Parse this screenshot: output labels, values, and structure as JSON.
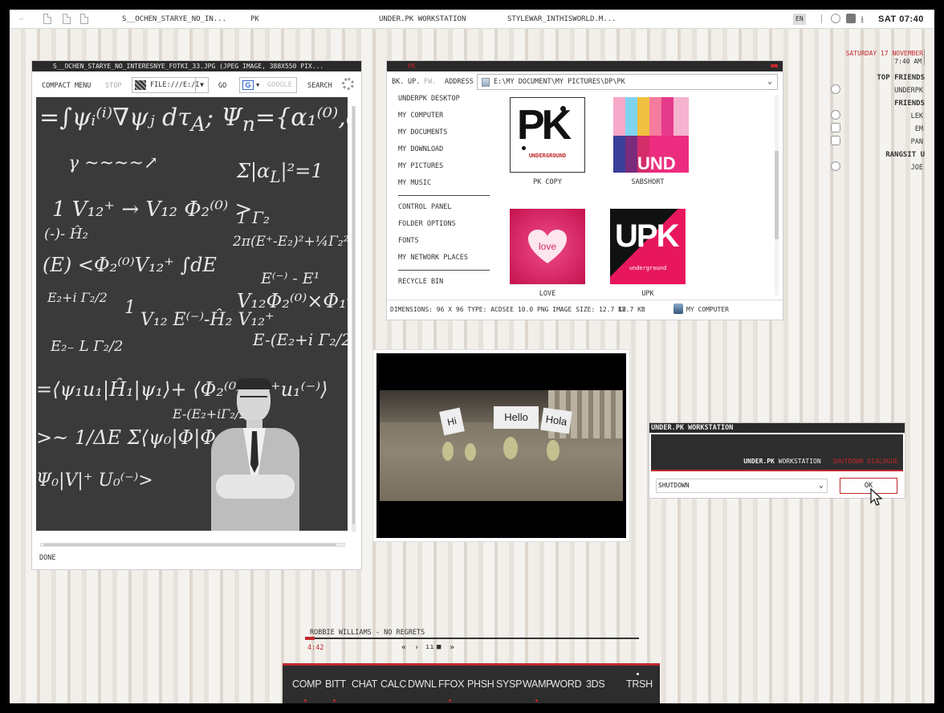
{
  "topbar": {
    "minimize_glyph": "–",
    "tasks": [
      "S__OCHEN_STARYE_NO_IN...",
      "PK",
      "UNDER.PK WORKSTATION",
      "STYLEWAR_INTHISWORLD.M..."
    ],
    "lang": "EN",
    "clock": "SAT 07:40"
  },
  "image_viewer": {
    "title": "S__OCHEN_STARYE_NO_INTERESNYE_FOTKI_33.JPG (JPEG IMAGE, 388X550 PIX...",
    "toolbar": {
      "compact_menu": "COMPACT MENU",
      "stop": "STOP",
      "url": "FILE:///E:/I",
      "go": "GO",
      "google_placeholder": "GOOGLE",
      "search": "SEARCH"
    },
    "status": "DONE"
  },
  "explorer": {
    "title": "PK",
    "nav": {
      "back": "BK.",
      "up": "UP.",
      "forward": "FW.",
      "address_label": "ADDRESS"
    },
    "address": "E:\\MY DOCUMENT\\MY PICTURES\\DP\\PK",
    "sidebar_group1": [
      "UNDERPK DESKTOP",
      "MY COMPUTER",
      "MY DOCUMENTS",
      "MY DOWNLOAD",
      "MY PICTURES",
      "MY MUSIC"
    ],
    "sidebar_group2": [
      "CONTROL PANEL",
      "FOLDER OPTIONS",
      "FONTS",
      "MY NETWORK PLACES"
    ],
    "sidebar_group3": [
      "RECYCLE BIN"
    ],
    "files": [
      {
        "name": "PK COPY",
        "art": "PK",
        "art_sub": "UNDERGROUND"
      },
      {
        "name": "SABSHORT",
        "art": "UND"
      },
      {
        "name": "LOVE",
        "art": "love"
      },
      {
        "name": "UPK",
        "art": "UPK",
        "art_sub": "underground"
      }
    ],
    "status": {
      "info": "DIMENSIONS: 96 X 96 TYPE: ACDSEE 10.0 PNG IMAGE SIZE: 12.7 KB",
      "size": "12.7 KB",
      "location": "MY COMPUTER"
    }
  },
  "video": {
    "signs": [
      "Hi",
      "Hello",
      "Hola"
    ]
  },
  "friends_panel": {
    "date": "SATURDAY 17 NOVEMBER",
    "time": "7:40 AM",
    "groups": [
      {
        "heading": "TOP FRIENDS",
        "names": [
          "UNDERPK"
        ]
      },
      {
        "heading": "FRIENDS",
        "names": [
          "LEK",
          "EM",
          "PAN"
        ]
      },
      {
        "heading": "RANGSIT U",
        "names": [
          "JOE"
        ]
      }
    ]
  },
  "shutdown": {
    "title": "UNDER.PK WORKSTATION",
    "brand_bold": "UNDER.PK",
    "brand_rest": " WORKSTATION",
    "brand_sep": " - ",
    "brand_dialog": "SHUTDOWN DIALOGUE",
    "option": "SHUTDOWN",
    "ok": "OK"
  },
  "player": {
    "track": "ROBBIE WILLIAMS - NO REGRETS",
    "time": "4:42",
    "progress": 0.03,
    "controls": [
      "«",
      "›",
      "ıı",
      "■",
      "»"
    ]
  },
  "dock": {
    "items": [
      "COMP",
      "BITT",
      "CHAT",
      "CALC",
      "DWNL",
      "FFOX",
      "PHSH",
      "SYSP",
      "WAMP",
      "WORD",
      "3DS",
      "TRSH"
    ]
  },
  "colors": {
    "accent_red": "#c0282d",
    "title_dark": "#2a2a2a",
    "dock_bg": "#2d2d2d"
  }
}
